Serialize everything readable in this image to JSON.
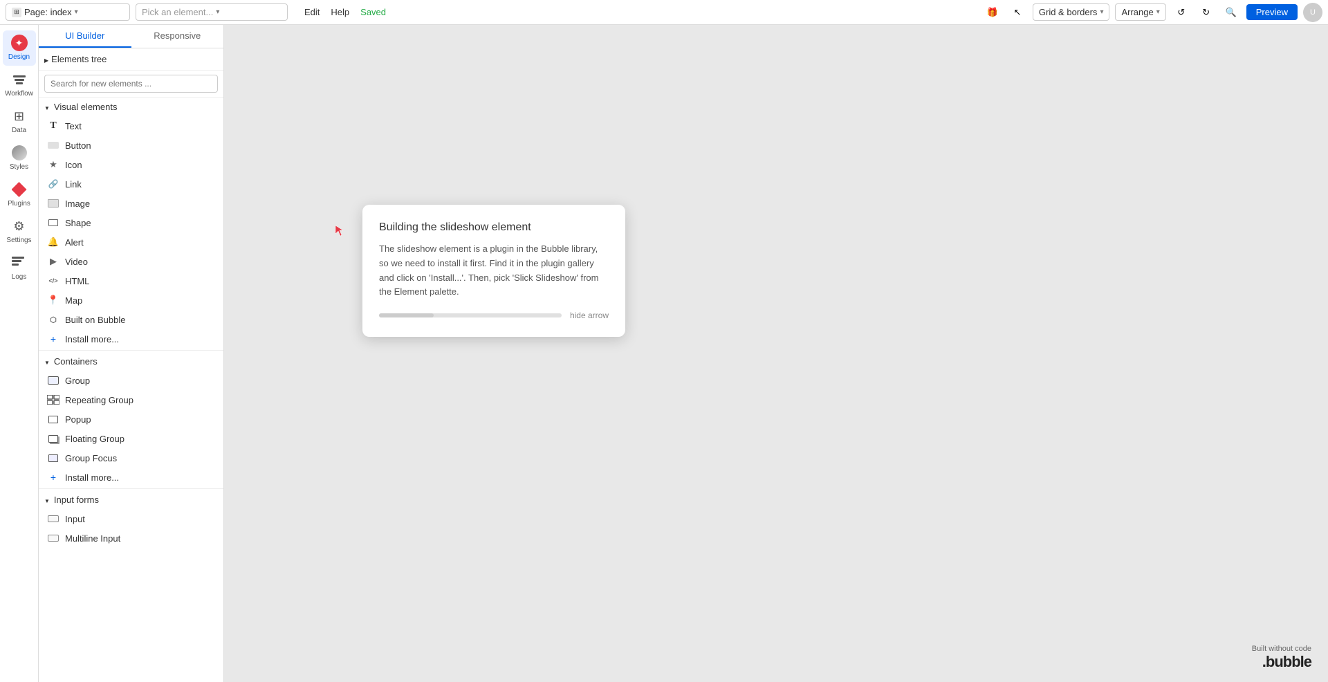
{
  "topbar": {
    "page_label": "Page: index",
    "page_dropdown_icon": "chevron-down",
    "element_picker": "Pick an element...",
    "element_picker_icon": "chevron-down",
    "edit_label": "Edit",
    "help_label": "Help",
    "saved_label": "Saved",
    "grid_borders_label": "Grid & borders",
    "arrange_label": "Arrange",
    "preview_label": "Preview"
  },
  "left_sidebar": {
    "items": [
      {
        "id": "design",
        "label": "Design",
        "active": true
      },
      {
        "id": "workflow",
        "label": "Workflow",
        "active": false
      },
      {
        "id": "data",
        "label": "Data",
        "active": false
      },
      {
        "id": "styles",
        "label": "Styles",
        "active": false
      },
      {
        "id": "plugins",
        "label": "Plugins",
        "active": false
      },
      {
        "id": "settings",
        "label": "Settings",
        "active": false
      },
      {
        "id": "logs",
        "label": "Logs",
        "active": false
      }
    ]
  },
  "panel": {
    "tabs": [
      {
        "id": "ui_builder",
        "label": "UI Builder",
        "active": true
      },
      {
        "id": "responsive",
        "label": "Responsive",
        "active": false
      }
    ],
    "elements_tree_label": "Elements tree",
    "search_placeholder": "Search for new elements ...",
    "visual_elements": {
      "label": "Visual elements",
      "items": [
        {
          "id": "text",
          "label": "Text",
          "icon": "text-icon"
        },
        {
          "id": "button",
          "label": "Button",
          "icon": "button-icon"
        },
        {
          "id": "icon",
          "label": "Icon",
          "icon": "icon-icon"
        },
        {
          "id": "link",
          "label": "Link",
          "icon": "link-icon"
        },
        {
          "id": "image",
          "label": "Image",
          "icon": "image-icon"
        },
        {
          "id": "shape",
          "label": "Shape",
          "icon": "shape-icon"
        },
        {
          "id": "alert",
          "label": "Alert",
          "icon": "alert-icon"
        },
        {
          "id": "video",
          "label": "Video",
          "icon": "video-icon"
        },
        {
          "id": "html",
          "label": "HTML",
          "icon": "html-icon"
        },
        {
          "id": "map",
          "label": "Map",
          "icon": "map-icon"
        },
        {
          "id": "built_on_bubble",
          "label": "Built on Bubble",
          "icon": "bubble-icon"
        },
        {
          "id": "install_more_visual",
          "label": "Install more...",
          "icon": "plus-icon"
        }
      ]
    },
    "containers": {
      "label": "Containers",
      "items": [
        {
          "id": "group",
          "label": "Group",
          "icon": "group-icon"
        },
        {
          "id": "repeating_group",
          "label": "Repeating Group",
          "icon": "repeat-icon"
        },
        {
          "id": "popup",
          "label": "Popup",
          "icon": "popup-icon"
        },
        {
          "id": "floating_group",
          "label": "Floating Group",
          "icon": "float-icon"
        },
        {
          "id": "group_focus",
          "label": "Group Focus",
          "icon": "focus-icon"
        },
        {
          "id": "install_more_containers",
          "label": "Install more...",
          "icon": "plus-icon"
        }
      ]
    },
    "input_forms": {
      "label": "Input forms",
      "items": [
        {
          "id": "input",
          "label": "Input",
          "icon": "input-icon"
        },
        {
          "id": "multiline",
          "label": "Multiline Input",
          "icon": "input-icon"
        }
      ]
    }
  },
  "tooltip": {
    "title": "Building the slideshow element",
    "body": "The slideshow element is a plugin in the Bubble library, so we need to install it first. Find it in the plugin gallery and click on 'Install...'. Then, pick 'Slick Slideshow' from the Element palette.",
    "progress_percent": 30,
    "hide_arrow_label": "hide arrow"
  },
  "watermark": {
    "built_text": "Built without code",
    "logo_text": ".bubble"
  }
}
